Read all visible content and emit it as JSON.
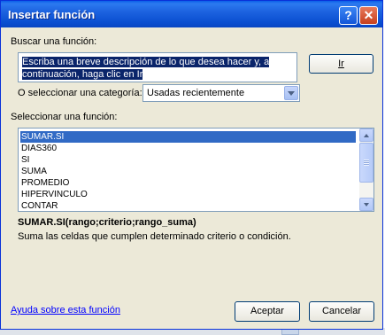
{
  "window": {
    "title": "Insertar función",
    "help_button": "?",
    "close_button": "✕"
  },
  "search": {
    "label": "Buscar una función:",
    "text_line1": "Escriba una breve descripción de lo que desea hacer y, a",
    "text_line2": "continuación, haga clic en Ir",
    "go_button": "Ir"
  },
  "category": {
    "label": "O seleccionar una categoría:",
    "selected": "Usadas recientemente"
  },
  "functions": {
    "label": "Seleccionar una función:",
    "items": [
      "SUMAR.SI",
      "DIAS360",
      "SI",
      "SUMA",
      "PROMEDIO",
      "HIPERVINCULO",
      "CONTAR"
    ],
    "selected_index": 0,
    "syntax": "SUMAR.SI(rango;criterio;rango_suma)",
    "description": "Suma las celdas que cumplen determinado criterio o condición."
  },
  "footer": {
    "help_link": "Ayuda sobre esta función",
    "accept_button": "Aceptar",
    "cancel_button": "Cancelar"
  },
  "colors": {
    "titlebar": "#0a4fd1",
    "dialog_bg": "#ece9d8",
    "selection": "#316ac5",
    "link": "#0000ff"
  }
}
